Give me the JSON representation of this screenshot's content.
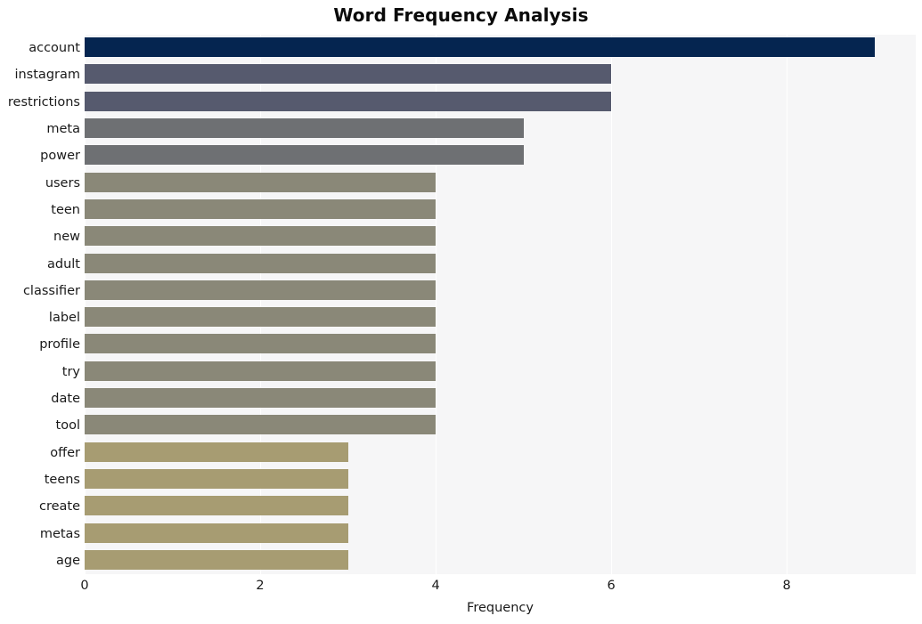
{
  "chart_data": {
    "type": "bar",
    "orientation": "horizontal",
    "title": "Word Frequency Analysis",
    "xlabel": "Frequency",
    "ylabel": "",
    "categories": [
      "account",
      "instagram",
      "restrictions",
      "meta",
      "power",
      "users",
      "teen",
      "new",
      "adult",
      "classifier",
      "label",
      "profile",
      "try",
      "date",
      "tool",
      "offer",
      "teens",
      "create",
      "metas",
      "age"
    ],
    "values": [
      9,
      6,
      6,
      5,
      5,
      4,
      4,
      4,
      4,
      4,
      4,
      4,
      4,
      4,
      4,
      3,
      3,
      3,
      3,
      3
    ],
    "bar_colors": [
      "#052550",
      "#565a6e",
      "#565a6e",
      "#6e7073",
      "#6e7073",
      "#8a8878",
      "#8a8878",
      "#8a8878",
      "#8a8878",
      "#8a8878",
      "#8a8878",
      "#8a8878",
      "#8a8878",
      "#8a8878",
      "#8a8878",
      "#a79c72",
      "#a79c72",
      "#a79c72",
      "#a79c72",
      "#a79c72"
    ],
    "xticks": [
      0,
      2,
      4,
      6,
      8
    ],
    "xtick_labels": [
      "0",
      "2",
      "4",
      "6",
      "8"
    ],
    "xlim": [
      0,
      9.47
    ],
    "grid": true,
    "grid_axis": "x",
    "legend": null,
    "plot_background": "#f6f6f7",
    "figure_background": "#ffffff"
  }
}
